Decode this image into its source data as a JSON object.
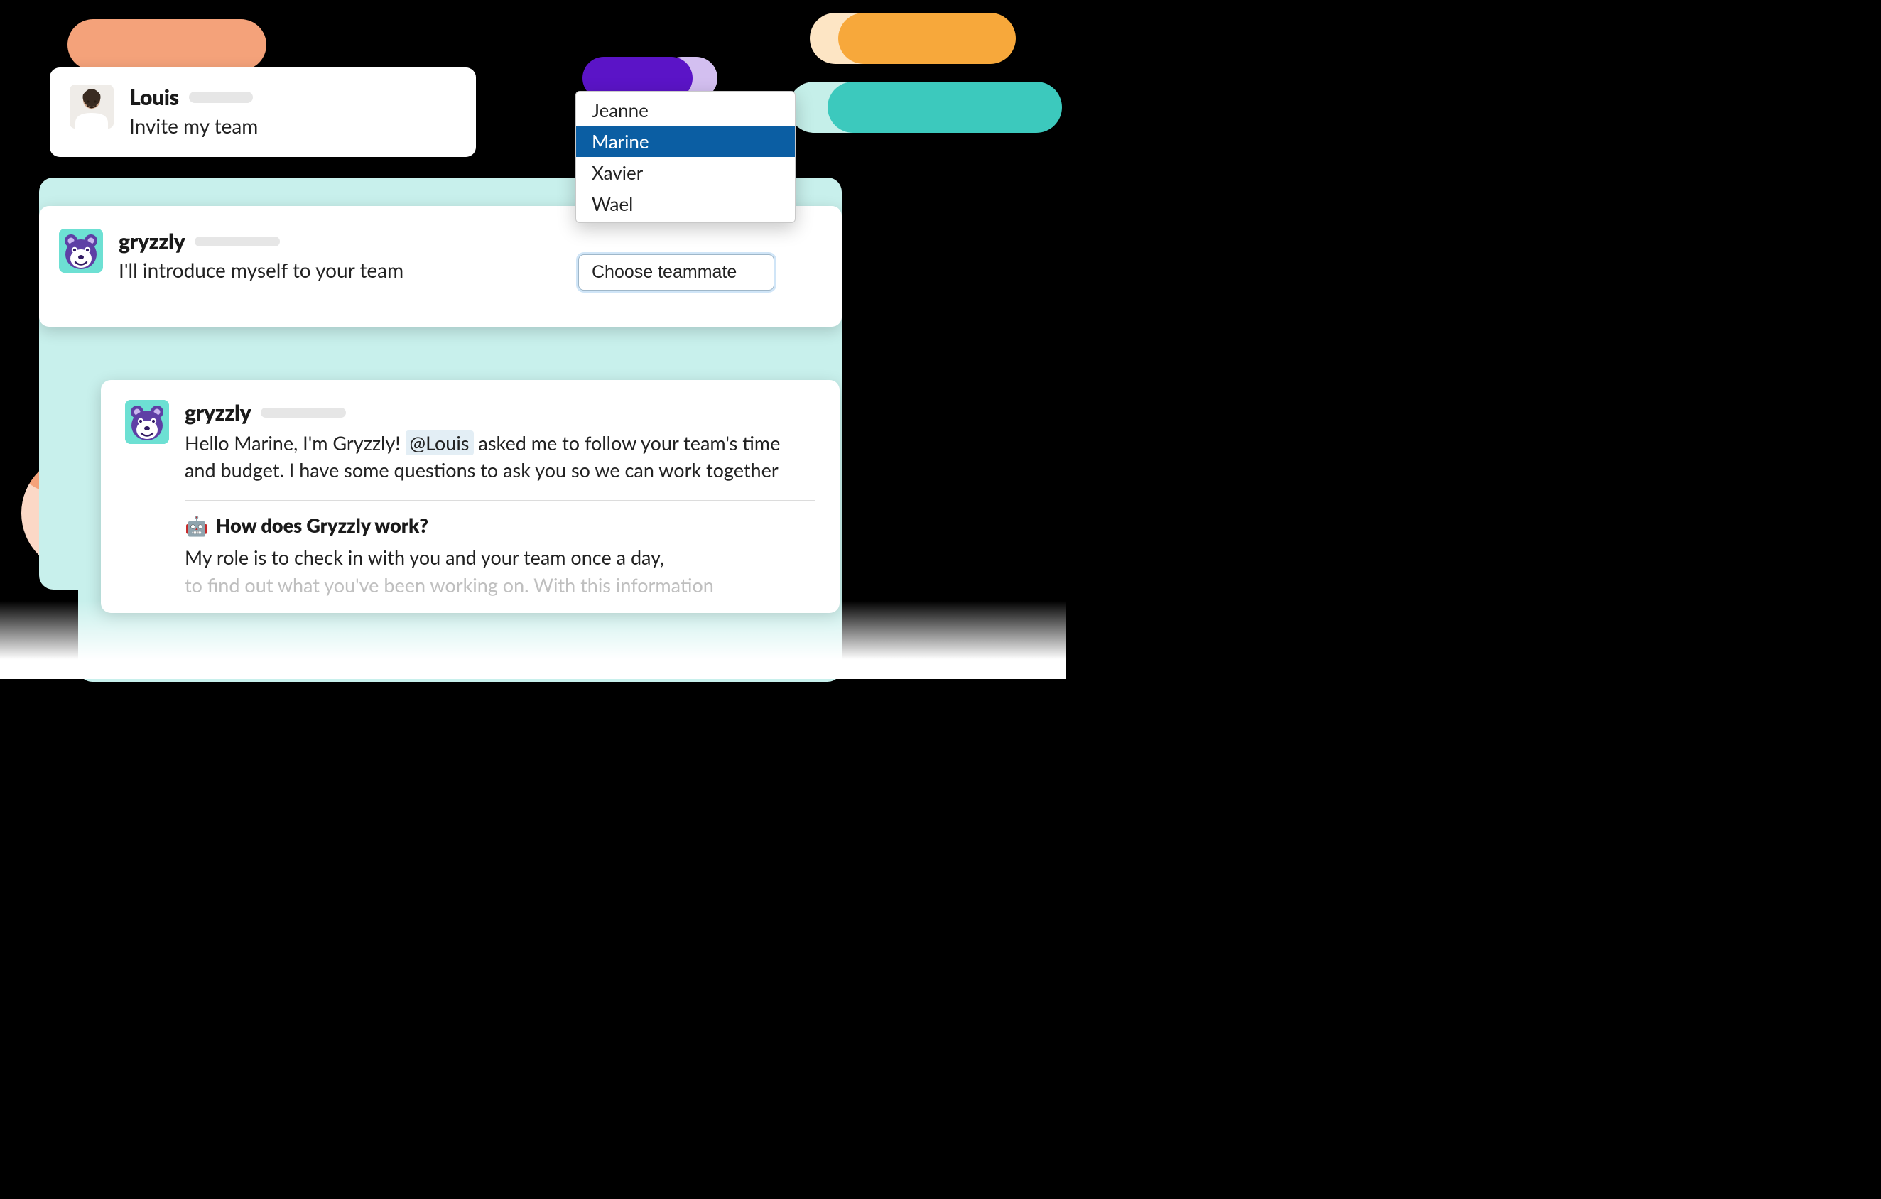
{
  "decor": {
    "colors": {
      "orange": "#f4a27a",
      "amber": "#f7a83b",
      "teal": "#3cc9bd",
      "purple": "#5b14c7",
      "tealPanel": "#c8f0ec"
    }
  },
  "card_louis": {
    "name": "Louis",
    "text": "Invite my team"
  },
  "card_gryzzly1": {
    "name": "gryzzly",
    "text": "I'll introduce myself to your team"
  },
  "choose_button": {
    "label": "Choose teammate"
  },
  "dropdown": {
    "items": [
      "Jeanne",
      "Marine",
      "Xavier",
      "Wael"
    ],
    "selected_index": 1
  },
  "card_gryzzly2": {
    "name": "gryzzly",
    "greeting_pre": "Hello Marine, I'm Gryzzly! ",
    "mention": "@Louis",
    "greeting_post": " asked me to follow your team's time and budget. I have some questions to ask you so we can work together",
    "question_title": "How does Gryzzly work?",
    "question_body_line1": "My role is to check in with you and your team once a day,",
    "question_body_line2": "to find out what you've been working on. With this information"
  }
}
